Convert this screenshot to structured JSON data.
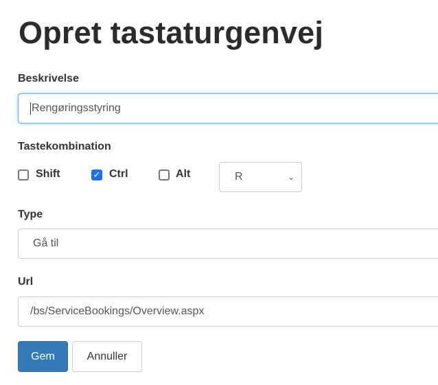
{
  "title": "Opret tastaturgenvej",
  "description": {
    "label": "Beskrivelse",
    "value": "Rengøringsstyring"
  },
  "key_combination": {
    "label": "Tastekombination",
    "modifiers": [
      {
        "label": "Shift",
        "checked": false
      },
      {
        "label": "Ctrl",
        "checked": true
      },
      {
        "label": "Alt",
        "checked": false
      }
    ],
    "key": "R",
    "checkbox_color": "#1a73e8"
  },
  "type": {
    "label": "Type",
    "value": "Gå til"
  },
  "url": {
    "label": "Url",
    "value": "/bs/ServiceBookings/Overview.aspx"
  },
  "buttons": {
    "save": "Gem",
    "cancel": "Annuller",
    "primary_color": "#337ab7"
  }
}
